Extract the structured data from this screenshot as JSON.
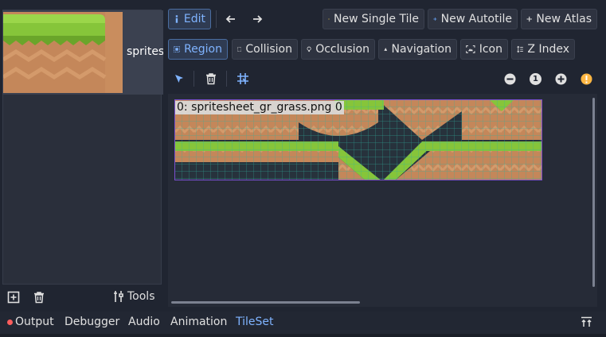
{
  "left_panel": {
    "tileset_label": "sprites",
    "tools_label": "Tools"
  },
  "toolbar_top": {
    "edit_label": "Edit",
    "new_single_tile_label": "New Single Tile",
    "new_autotile_label": "New Autotile",
    "new_atlas_label": "New Atlas"
  },
  "toolbar_modes": {
    "region_label": "Region",
    "collision_label": "Collision",
    "occlusion_label": "Occlusion",
    "navigation_label": "Navigation",
    "icon_label": "Icon",
    "z_index_label": "Z Index",
    "active": "Region"
  },
  "tool_icons": [
    "select-icon",
    "delete-icon",
    "grid-snap-icon",
    "zoom-out-icon",
    "zoom-reset-icon",
    "zoom-in-icon",
    "warning-icon"
  ],
  "zoom_reset_text": "1",
  "viewport": {
    "sprite_label": "0: spritesheet_gr_grass.png 0"
  },
  "bottom_tabs": [
    {
      "label": "Output",
      "has_error": true
    },
    {
      "label": "Debugger"
    },
    {
      "label": "Audio"
    },
    {
      "label": "Animation"
    },
    {
      "label": "TileSet",
      "active": true
    }
  ],
  "colors": {
    "accent": "#7fb3ff",
    "grass": "#86c53a",
    "dirt": "#c4875a",
    "warning": "#ffb743",
    "error": "#ff5d5d"
  }
}
